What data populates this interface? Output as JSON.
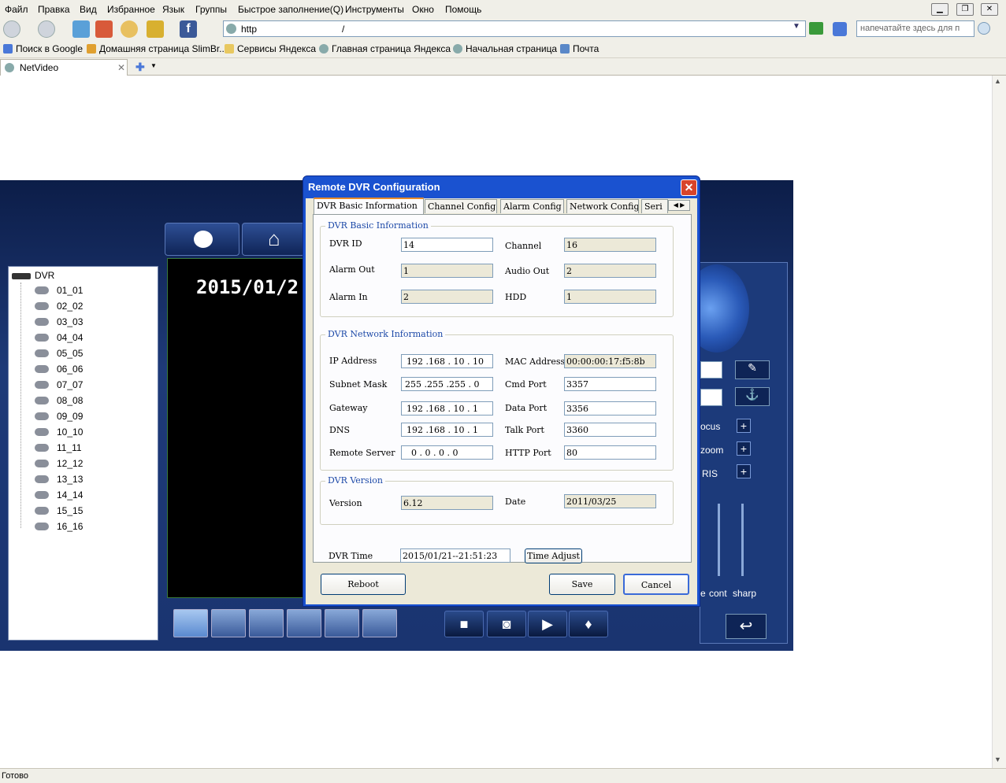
{
  "browser": {
    "menu": [
      "Файл",
      "Правка",
      "Вид",
      "Избранное",
      "Язык",
      "Группы",
      "Быстрое заполнение(Q)",
      "Инструменты",
      "Окно",
      "Помощь"
    ],
    "address": "http",
    "address_suffix": "/",
    "search_placeholder": "напечатайте здесь для п",
    "favorites": [
      "Поиск в Google",
      "Домашняя страница SlimBr...",
      "Сервисы Яндекса",
      "Главная страница Яндекса",
      "Начальная страница",
      "Почта"
    ],
    "tab_title": "NetVideo",
    "status": "Готово"
  },
  "app": {
    "tree_root": "DVR",
    "channels": [
      "01_01",
      "02_02",
      "03_03",
      "04_04",
      "05_05",
      "06_06",
      "07_07",
      "08_08",
      "09_09",
      "10_10",
      "11_11",
      "12_12",
      "13_13",
      "14_14",
      "15_15",
      "16_16"
    ],
    "video_date": "2015/01/2",
    "ptz_labels": {
      "focus": "ocus",
      "zoom": "zoom",
      "iris": "RIS",
      "cont": "cont",
      "sharp": "sharp",
      "e": "e"
    }
  },
  "dialog": {
    "title": "Remote DVR Configuration",
    "tabs": [
      "DVR Basic Information",
      "Channel Config",
      "Alarm Config",
      "Network Config",
      "Seri"
    ],
    "basic_group": "DVR Basic Information",
    "dvr_id_label": "DVR ID",
    "dvr_id": "14",
    "channel_label": "Channel",
    "channel": "16",
    "alarm_out_label": "Alarm Out",
    "alarm_out": "1",
    "audio_out_label": "Audio Out",
    "audio_out": "2",
    "alarm_in_label": "Alarm In",
    "alarm_in": "2",
    "hdd_label": "HDD",
    "hdd": "1",
    "network_group": "DVR Network Information",
    "ip_label": "IP Address",
    "ip": "192 .168 . 10  . 10",
    "mac_label": "MAC Address",
    "mac": "00:00:00:17:f5:8b",
    "subnet_label": "Subnet Mask",
    "subnet": "255 .255 .255 . 0",
    "cmd_port_label": "Cmd Port",
    "cmd_port": "3357",
    "gateway_label": "Gateway",
    "gateway": "192 .168 . 10  . 1",
    "data_port_label": "Data Port",
    "data_port": "3356",
    "dns_label": "DNS",
    "dns": "192 .168 . 10  . 1",
    "talk_port_label": "Talk Port",
    "talk_port": "3360",
    "remote_server_label": "Remote Server",
    "remote_server": "0  . 0  . 0  . 0",
    "http_port_label": "HTTP Port",
    "http_port": "80",
    "version_group": "DVR Version",
    "version_label": "Version",
    "version": "6.12",
    "date_label": "Date",
    "date": "2011/03/25",
    "time_label": "DVR Time",
    "time": "2015/01/21--21:51:23",
    "time_adjust": "Time Adjust",
    "reboot": "Reboot",
    "save": "Save",
    "cancel": "Cancel"
  }
}
